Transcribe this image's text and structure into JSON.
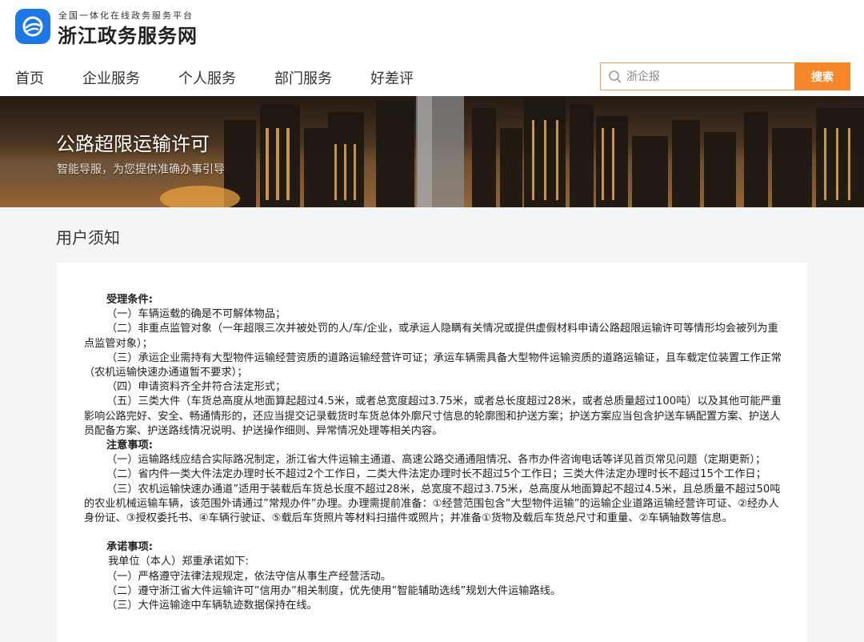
{
  "header": {
    "brand_small": "全国一体化在线政务服务平台",
    "brand_title": "浙江政务服务网",
    "logo_icon": "zhejiang-logo-icon",
    "accent_color": "#f5862a",
    "logo_color": "#1d78e6"
  },
  "nav": {
    "items": [
      {
        "label": "首页"
      },
      {
        "label": "企业服务"
      },
      {
        "label": "个人服务"
      },
      {
        "label": "部门服务"
      },
      {
        "label": "好差评"
      }
    ]
  },
  "search": {
    "placeholder": "浙企报",
    "button_label": "搜索",
    "icon": "search-icon"
  },
  "banner": {
    "title": "公路超限运输许可",
    "subtitle": "智能导服，为您提供准确办事引导"
  },
  "section": {
    "title": "用户须知"
  },
  "notice": {
    "acceptance_heading": "受理条件:",
    "acceptance": [
      "（一）车辆运载的确是不可解体物品；",
      "（二）非重点监管对象（一年超限三次并被处罚的人/车/企业，或承运人隐瞒有关情况或提供虚假材料申请公路超限运输许可等情形均会被列为重点监管对象）；",
      "（三）承运企业需持有大型物件运输经营资质的道路运输经营许可证；承运车辆需具备大型物件运输资质的道路运输证，且车载定位装置工作正常（农机运输快速办通道暂不要求）；",
      "（四）申请资料齐全并符合法定形式；",
      "（五）三类大件（车货总高度从地面算起超过4.5米，或者总宽度超过3.75米，或者总长度超过28米，或者总质量超过100吨）以及其他可能严重影响公路完好、安全、畅通情形的，还应当提交记录载货时车货总体外廓尺寸信息的轮廓图和护送方案；护送方案应当包含护送车辆配置方案、护送人员配备方案、护送路线情况说明、护送操作细则、异常情况处理等相关内容。"
    ],
    "notes_heading": "注意事项:",
    "notes": [
      "（一）运输路线应结合实际路况制定，浙江省大件运输主通道、高速公路交通通阻情况、各市办件咨询电话等详见首页常见问题（定期更新）；",
      "（二）省内件一类大件法定办理时长不超过2个工作日，二类大件法定办理时长不超过5个工作日；三类大件法定办理时长不超过15个工作日；",
      "（三）农机运输快速办通道”适用于装载后车货总长度不超过28米，总宽度不超过3.75米，总高度从地面算起不超过4.5米，且总质量不超过50吨的农业机械运输车辆，该范围外请通过”常规办件”办理。办理需提前准备：①经营范围包含”大型物件运输”的运输企业道路运输经营许可证、②经办人身份证、③授权委托书、④车辆行驶证、⑤载后车货照片等材料扫描件或照片；并准备①货物及载后车货总尺寸和重量、②车辆轴数等信息。"
    ],
    "promise_heading": "承诺事项:",
    "promise_intro": "我单位（本人）郑重承诺如下:",
    "promises": [
      "（一）严格遵守法律法规规定，依法守信从事生产经营活动。",
      "（二）遵守浙江省大件运输许可”信用办”相关制度，优先使用”智能辅助选线”规划大件运输路线。",
      "（三）大件运输途中车辆轨迹数据保持在线。"
    ]
  }
}
